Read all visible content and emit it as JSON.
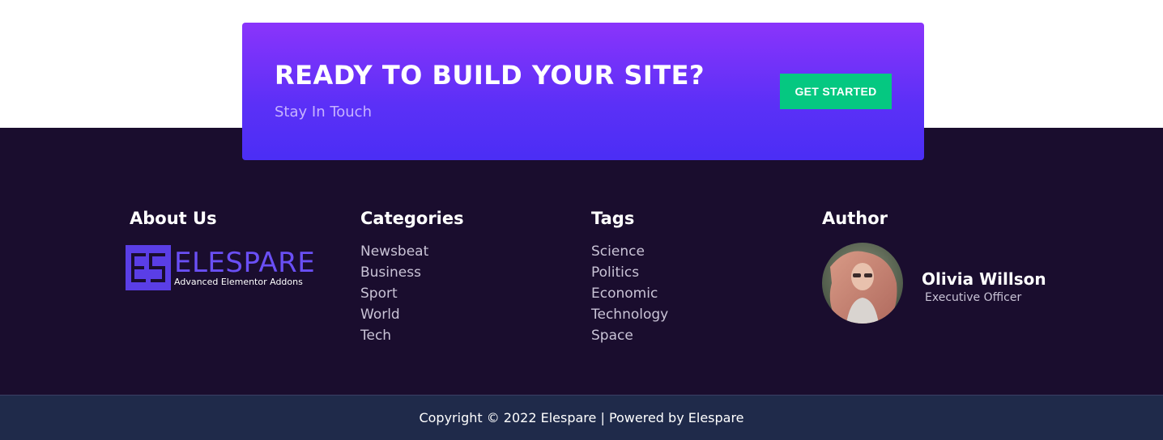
{
  "cta": {
    "title": "READY TO BUILD YOUR SITE?",
    "subtitle": "Stay In Touch",
    "button_label": "GET STARTED",
    "gradient_top": "#8a34fb",
    "gradient_bottom": "#4b2ef5",
    "button_color": "#05c881"
  },
  "about": {
    "heading": "About Us",
    "logo": {
      "name": "ELESPARE",
      "tagline": "Advanced Elementor Addons"
    }
  },
  "categories": {
    "heading": "Categories",
    "items": [
      "Newsbeat",
      "Business",
      "Sport",
      "World",
      "Tech"
    ]
  },
  "tags": {
    "heading": "Tags",
    "items": [
      "Science",
      "Politics",
      "Economic",
      "Technology",
      "Space"
    ]
  },
  "author": {
    "heading": "Author",
    "name": "Olivia Willson",
    "role": "Executive Officer",
    "avatar_icon": "avatar-photo"
  },
  "footer": {
    "copyright": "Copyright © 2022 Elespare | Powered by Elespare",
    "background": "#1a0d2e",
    "bottom_background": "#1f2a4a"
  }
}
